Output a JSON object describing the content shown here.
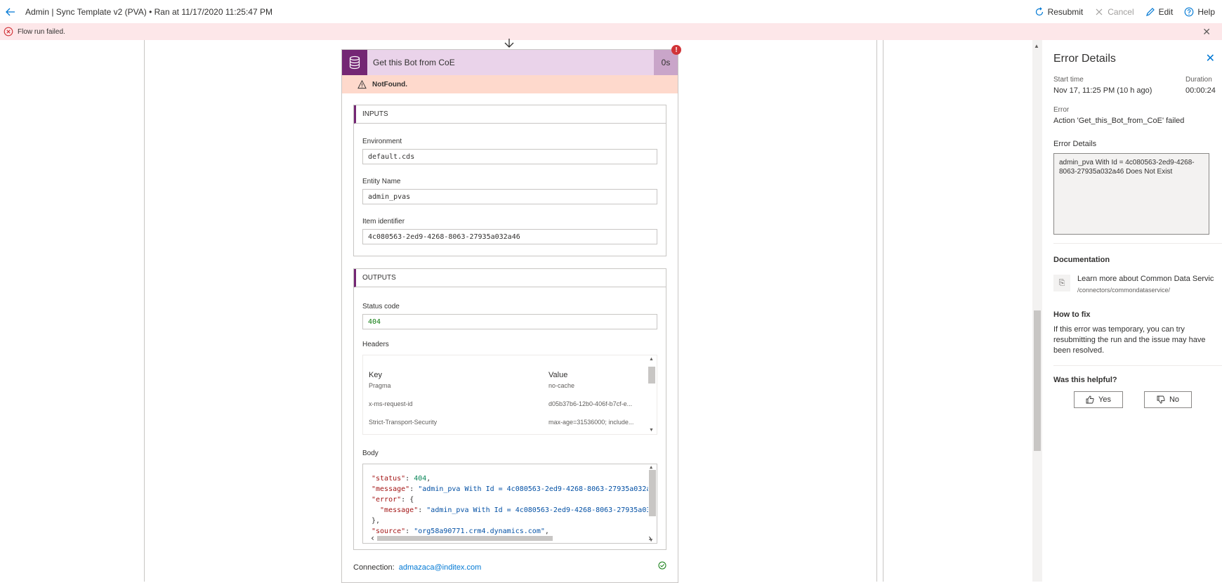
{
  "header": {
    "title": "Admin | Sync Template v2 (PVA)",
    "separator": "•",
    "run_info": "Ran at 11/17/2020 11:25:47 PM",
    "commands": {
      "resubmit": "Resubmit",
      "cancel": "Cancel",
      "edit": "Edit",
      "help": "Help"
    }
  },
  "banner": {
    "message": "Flow run failed."
  },
  "action": {
    "name": "Get this Bot from CoE",
    "duration": "0s",
    "badge": "!",
    "status": "NotFound.",
    "inputs": {
      "heading": "INPUTS",
      "fields": [
        {
          "label": "Environment",
          "value": "default.cds"
        },
        {
          "label": "Entity Name",
          "value": "admin_pvas"
        },
        {
          "label": "Item identifier",
          "value": "4c080563-2ed9-4268-8063-27935a032a46"
        }
      ]
    },
    "outputs": {
      "heading": "OUTPUTS",
      "status_code_label": "Status code",
      "status_code": "404",
      "headers_label": "Headers",
      "headers_columns": {
        "key": "Key",
        "value": "Value"
      },
      "headers_rows": [
        {
          "key": "Pragma",
          "value": "no-cache"
        },
        {
          "key": "x-ms-request-id",
          "value": "d05b37b6-12b0-406f-b7cf-e..."
        },
        {
          "key": "Strict-Transport-Security",
          "value": "max-age=31536000; include..."
        }
      ],
      "body_label": "Body",
      "body_lines": [
        {
          "k": "\"status\"",
          "v": "404",
          "vtype": "num",
          "suffix": ","
        },
        {
          "k": "\"message\"",
          "v": "\"admin_pva With Id = 4c080563-2ed9-4268-8063-27935a032a",
          "vtype": "str",
          "suffix": ""
        },
        {
          "k": "\"error\"",
          "v": "{",
          "vtype": "punc",
          "suffix": ""
        },
        {
          "k": "  \"message\"",
          "v": "\"admin_pva With Id = 4c080563-2ed9-4268-8063-27935a03",
          "vtype": "str",
          "suffix": ""
        },
        {
          "k": "",
          "v": "},",
          "vtype": "punc",
          "suffix": ""
        },
        {
          "k": "\"source\"",
          "v": "\"org58a90771.crm4.dynamics.com\"",
          "vtype": "str",
          "suffix": ","
        }
      ]
    },
    "connection_label": "Connection:",
    "connection_value": "admazaca@inditex.com"
  },
  "panel": {
    "title": "Error Details",
    "start_time_label": "Start time",
    "start_time": "Nov 17, 11:25 PM (10 h ago)",
    "duration_label": "Duration",
    "duration": "00:00:24",
    "error_label": "Error",
    "error_text": "Action 'Get_this_Bot_from_CoE' failed",
    "error_details_label": "Error Details",
    "error_details": "admin_pva With Id = 4c080563-2ed9-4268-8063-27935a032a46 Does Not Exist",
    "documentation_label": "Documentation",
    "doc_link_text": "Learn more about Common Data Servic",
    "doc_link_path": "/connectors/commondataservice/",
    "how_to_fix_label": "How to fix",
    "how_to_fix_text": "If this error was temporary, you can try resubmitting the run and the issue may have been resolved.",
    "helpful_label": "Was this helpful?",
    "yes_label": "Yes",
    "no_label": "No"
  },
  "colors": {
    "accent": "#742774",
    "banner_bg": "#fde7e9",
    "error_red": "#d13438",
    "link_blue": "#0078d4"
  }
}
